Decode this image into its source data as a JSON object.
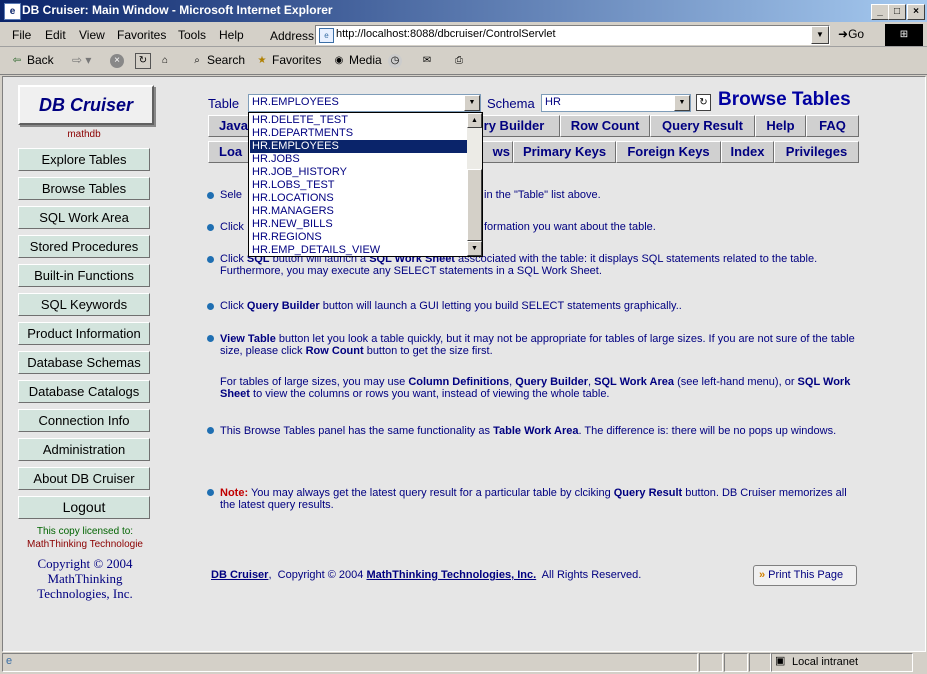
{
  "window": {
    "title": "DB Cruiser: Main Window - Microsoft Internet Explorer"
  },
  "menubar": {
    "items": [
      "File",
      "Edit",
      "View",
      "Favorites",
      "Tools",
      "Help"
    ],
    "address_label": "Address",
    "url": "http://localhost:8088/dbcruiser/ControlServlet",
    "go_label": "Go"
  },
  "toolbar": {
    "back": "Back",
    "search": "Search",
    "favorites": "Favorites",
    "media": "Media"
  },
  "sidebar": {
    "logo": "DB Cruiser",
    "db_name": "mathdb",
    "items": [
      "Explore Tables",
      "Browse Tables",
      "SQL Work Area",
      "Stored Procedures",
      "Built-in Functions",
      "SQL Keywords",
      "Product Information",
      "Database Schemas",
      "Database Catalogs",
      "Connection Info",
      "Administration",
      "About DB Cruiser",
      "Logout"
    ],
    "licensed_to": "This copy licensed to:",
    "licensee": "MathThinking Technologie",
    "copyright_lines": [
      "Copyright © 2004",
      "MathThinking",
      "Technologies, Inc."
    ]
  },
  "controls": {
    "table_label": "Table",
    "table_value": "HR.EMPLOYEES",
    "schema_label": "Schema",
    "schema_value": "HR",
    "heading": "Browse Tables"
  },
  "tabs_row1": [
    "Java",
    "ry Builder",
    "Row Count",
    "Query Result",
    "Help",
    "FAQ"
  ],
  "tabs_row2": [
    "Loa",
    "ws",
    "Primary Keys",
    "Foreign Keys",
    "Index",
    "Privileges"
  ],
  "dropdown": {
    "options": [
      "HR.DELETE_TEST",
      "HR.DEPARTMENTS",
      "HR.EMPLOYEES",
      "HR.JOBS",
      "HR.JOB_HISTORY",
      "HR.LOBS_TEST",
      "HR.LOCATIONS",
      "HR.MANAGERS",
      "HR.NEW_BILLS",
      "HR.REGIONS",
      "HR.EMP_DETAILS_VIEW"
    ],
    "selected": "HR.EMPLOYEES"
  },
  "instructions": {
    "p1_a": "Sele",
    "p1_b": "in the \"Table\" list above.",
    "p2_a": "Click",
    "p2_b": "formation you want about the table.",
    "p3_a": "Click ",
    "p3_b1": "SQL",
    "p3_c": " button will launch a ",
    "p3_b2": "SQL Work Sheet",
    "p3_d": " asscociated with the table: it displays SQL statements related to the table. Furthermore, you may execute any SELECT statements in a SQL Work Sheet.",
    "p4_a": "Click ",
    "p4_b": "Query Builder",
    "p4_c": " button will launch a GUI letting you build SELECT statements graphically..",
    "p5_b1": "View Table",
    "p5_a": " button let you look a table quickly, but it may not be appropriate for tables of large sizes. If you are not sure of the table size, please click ",
    "p5_b2": "Row Count",
    "p5_c": " button to get the size first.",
    "p6_a": "For tables of large sizes, you may use ",
    "p6_b1": "Column Definitions",
    "p6_s1": ", ",
    "p6_b2": "Query Builder",
    "p6_s2": ", ",
    "p6_b3": "SQL Work Area",
    "p6_c": " (see left-hand menu), or ",
    "p6_b4": "SQL Work Sheet",
    "p6_d": " to view the columns or rows you want, instead of viewing the whole table.",
    "p7_a": "This Browse Tables panel has the same functionality as ",
    "p7_b": "Table Work Area",
    "p7_c": ". The difference is: there will be no pops up windows.",
    "note_label": "Note:",
    "note_a": " You may always get the latest query result for a particular table by clciking ",
    "note_b": "Query Result",
    "note_c": " button. DB Cruiser memorizes all the latest query results."
  },
  "footer": {
    "product": "DB Cruiser",
    "sep": ",  Copyright © 2004 ",
    "company": "MathThinking Technologies, Inc.",
    "rights": "  All Rights Reserved.",
    "print": "Print This Page"
  },
  "statusbar": {
    "zone": "Local intranet"
  }
}
